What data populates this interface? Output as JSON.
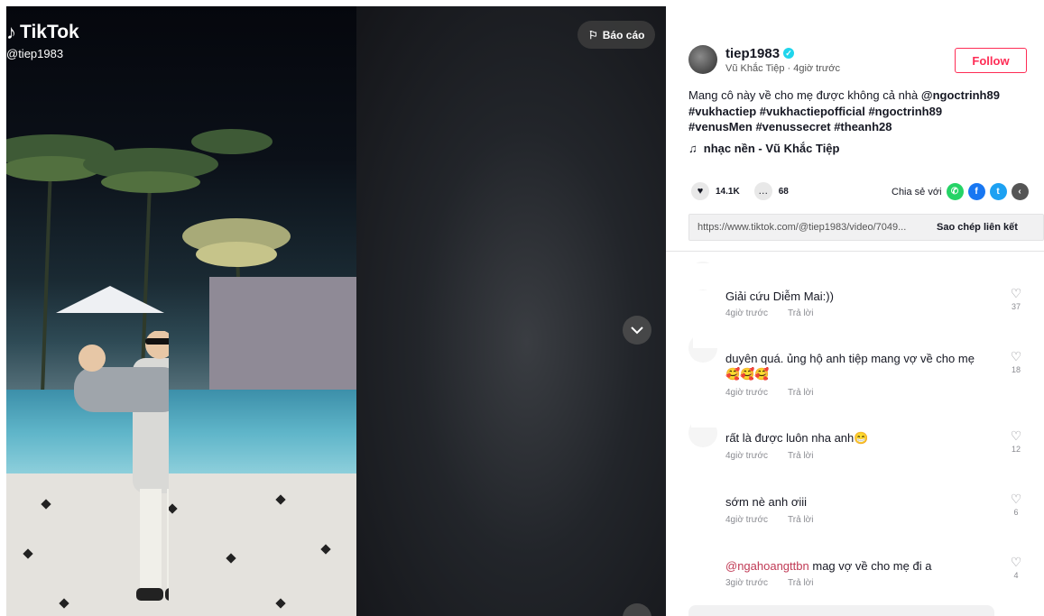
{
  "video": {
    "brand": "TikTok",
    "handle": "@tiep1983",
    "report_label": "Báo cáo"
  },
  "author": {
    "username": "tiep1983",
    "display_name": "Vũ Khắc Tiệp",
    "posted": "4giờ trước",
    "follow_label": "Follow"
  },
  "caption": {
    "text": "Mang cô này về cho mẹ được không cả nhà",
    "tags": [
      "@ngoctrinh89",
      "#vukhactiep",
      "#vukhactiepofficial",
      "#ngoctrinh89",
      "#venusMen",
      "#venussecret",
      "#theanh28"
    ]
  },
  "music": {
    "label": "nhạc nền - Vũ Khắc Tiệp"
  },
  "stats": {
    "likes": "14.1K",
    "comments": "68"
  },
  "share": {
    "label": "Chia sẻ với",
    "icons": [
      "whatsapp-icon",
      "facebook-icon",
      "twitter-icon",
      "share-more-icon"
    ],
    "colors": {
      "whatsapp": "#25d366",
      "facebook": "#1877f2",
      "twitter": "#1da1f2",
      "more": "#555555"
    }
  },
  "link": {
    "url": "https://www.tiktok.com/@tiep1983/video/7049...",
    "copy_label": "Sao chép liên kết"
  },
  "comments": [
    {
      "name": "",
      "text": "Giải cứu Diễm Mai:))",
      "time": "4giờ trước",
      "reply": "Trả lời",
      "likes": "37"
    },
    {
      "name": "",
      "text": "duyên quá. ủng hộ anh tiệp mang vợ về cho mẹ🥰🥰🥰",
      "time": "4giờ trước",
      "reply": "Trả lời",
      "likes": "18"
    },
    {
      "name": "",
      "text": "rất là được luôn nha anh😁",
      "time": "4giờ trước",
      "reply": "Trả lời",
      "likes": "12"
    },
    {
      "name": "",
      "text": "sớm nè anh ơiii",
      "time": "4giờ trước",
      "reply": "Trả lời",
      "likes": "6"
    },
    {
      "name": "",
      "mention": "@ngahoangttbn",
      "text": "mag vợ về cho mẹ đi a",
      "time": "3giờ trước",
      "reply": "Trả lời",
      "likes": "4"
    }
  ],
  "colors": {
    "accent": "#fe2c55",
    "mention": "#c03a55",
    "verified": "#20d5ec"
  }
}
